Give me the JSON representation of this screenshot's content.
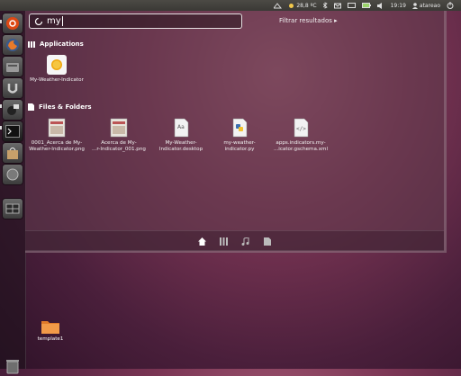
{
  "top_panel": {
    "temperature": "28,8 ºC",
    "time": "19:19",
    "user": "atareao"
  },
  "dash": {
    "search_value": "my",
    "filter_label": "Filtrar resultados ▸",
    "sections": [
      {
        "title": "Applications",
        "items": [
          {
            "label": "My-Weather-Indicator",
            "icon": "weather-app-icon"
          }
        ]
      },
      {
        "title": "Files & Folders",
        "items": [
          {
            "label": "0001_Acerca de My-\nWeather-Indicator.png",
            "icon": "image-file-icon"
          },
          {
            "label": "Acerca de My-\n...r-Indicator_001.png",
            "icon": "image-file-icon"
          },
          {
            "label": "My-Weather-\nIndicator.desktop",
            "icon": "desktop-file-icon"
          },
          {
            "label": "my-weather-\nindicator.py",
            "icon": "python-file-icon"
          },
          {
            "label": "apps.indicators.my-\n...icator.gschema.xml",
            "icon": "xml-file-icon"
          }
        ]
      }
    ],
    "lenses": [
      "home-lens-icon",
      "applications-lens-icon",
      "music-lens-icon",
      "files-lens-icon"
    ]
  },
  "desktop": {
    "folder_label": "template1"
  },
  "launcher_items": [
    "dash-home-icon",
    "firefox-icon",
    "nautilus-icon",
    "ubuntu-one-icon",
    "indicator-app-icon",
    "terminal-icon",
    "software-center-icon",
    "system-icon",
    "workspaces-icon",
    "trash-icon"
  ]
}
